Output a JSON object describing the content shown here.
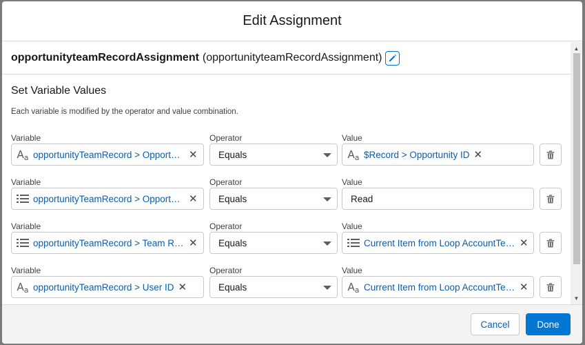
{
  "modal": {
    "title": "Edit Assignment"
  },
  "element": {
    "api_name": "opportunityteamRecordAssignment",
    "label": "(opportunityteamRecordAssignment)",
    "edit_icon": "pencil-icon"
  },
  "section": {
    "title": "Set Variable Values",
    "description": "Each variable is modified by the operator and value combination."
  },
  "labels": {
    "variable": "Variable",
    "operator": "Operator",
    "value": "Value"
  },
  "rows": [
    {
      "variable": "opportunityTeamRecord > Opportuni...",
      "variable_icon": "text-type-icon",
      "operator": "Equals",
      "value": "$Record > Opportunity ID",
      "value_icon": "text-type-icon",
      "value_is_pill": true
    },
    {
      "variable": "opportunityTeamRecord > Opportuni...",
      "variable_icon": "picklist-type-icon",
      "operator": "Equals",
      "value": "Read",
      "value_icon": "",
      "value_is_pill": false
    },
    {
      "variable": "opportunityTeamRecord > Team Role",
      "variable_icon": "picklist-type-icon",
      "operator": "Equals",
      "value": "Current Item from Loop AccountTea...",
      "value_icon": "picklist-type-icon",
      "value_is_pill": true
    },
    {
      "variable": "opportunityTeamRecord > User ID",
      "variable_icon": "text-type-icon",
      "operator": "Equals",
      "value": "Current Item from Loop AccountTea...",
      "value_icon": "text-type-icon",
      "value_is_pill": true
    }
  ],
  "footer": {
    "cancel_label": "Cancel",
    "done_label": "Done"
  },
  "colors": {
    "brand": "#0176d3",
    "link": "#0b5cab",
    "border": "#c9c9c9"
  }
}
